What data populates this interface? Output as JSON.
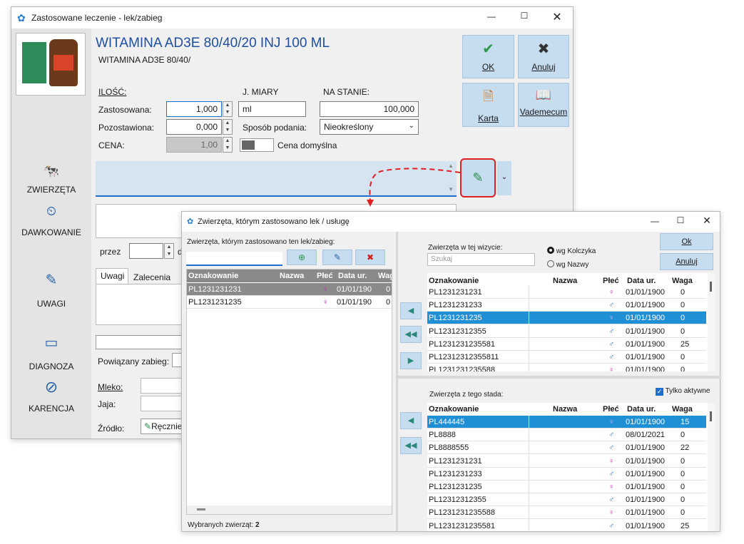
{
  "main": {
    "title": "Zastosowane leczenie - lek/zabieg",
    "drug_title": "WITAMINA AD3E 80/40/20 INJ 100 ML",
    "drug_subtitle": "WITAMINA AD3E 80/40/",
    "ilosc_label": "ILOŚĆ:",
    "jm_label": "J. MIARY",
    "na_stanie_label": "NA STANIE:",
    "zastosowana_label": "Zastosowana:",
    "zastosowana_value": "1,000",
    "jm_value": "ml",
    "na_stanie_value": "100,000",
    "pozostawiona_label": "Pozostawiona:",
    "pozostawiona_value": "0,000",
    "sposob_label": "Sposób podania:",
    "sposob_value": "Nieokreślony",
    "cena_label": "CENA:",
    "cena_value": "1,00",
    "cena_domyslna_label": "Cena domyślna",
    "ok_label": "OK",
    "anuluj_label": "Anuluj",
    "karta_label": "Karta",
    "vademecum_label": "Vademecum",
    "przez_label": "przez",
    "przez_suffix": "d",
    "tab_uwagi": "Uwagi",
    "tab_zalecenia": "Zalecenia",
    "powiazany_label": "Powiązany zabieg:",
    "mleko_label": "Mleko:",
    "jaja_label": "Jaja:",
    "zrodlo_label": "Źródło:",
    "zrodlo_value": "Ręcznie",
    "sidebar": [
      {
        "label": "ZWIERZĘTA",
        "icon": "cow-icon"
      },
      {
        "label": "DAWKOWANIE",
        "icon": "dosage-icon"
      },
      {
        "label": "UWAGI",
        "icon": "pencil-icon"
      },
      {
        "label": "DIAGNOZA",
        "icon": "diagnosis-icon"
      },
      {
        "label": "KARENCJA",
        "icon": "withdrawal-icon"
      }
    ]
  },
  "dialog": {
    "title": "Zwierzęta, którym zastosowano lek / usługę",
    "left_caption": "Zwierzęta, którym zastosowano ten lek/zabieg:",
    "left_columns": [
      "Oznakowanie",
      "Nazwa",
      "Płeć",
      "Data ur.",
      "Wag"
    ],
    "left_rows": [
      {
        "id": "PL1231231231",
        "name": "",
        "sex": "♀",
        "date": "01/01/190",
        "weight": "0"
      },
      {
        "id": "PL1231231235",
        "name": "",
        "sex": "♀",
        "date": "01/01/190",
        "weight": "0"
      }
    ],
    "selected_count_label": "Wybranych zwierząt:",
    "selected_count": "2",
    "visit_caption": "Zwierzęta w tej wizycie:",
    "search_placeholder": "Szukaj",
    "radio_kolczyk": "wg Kolczyka",
    "radio_nazwy": "wg Nazwy",
    "ok_label": "Ok",
    "anuluj_label": "Anuluj",
    "columns": [
      "Oznakowanie",
      "Nazwa",
      "Płeć",
      "Data ur.",
      "Waga"
    ],
    "visit_rows": [
      {
        "id": "PL1231231231",
        "name": "",
        "sex": "♀",
        "date": "01/01/1900",
        "weight": "0"
      },
      {
        "id": "PL1231231233",
        "name": "",
        "sex": "♂",
        "date": "01/01/1900",
        "weight": "0"
      },
      {
        "id": "PL1231231235",
        "name": "",
        "sex": "♀",
        "date": "01/01/1900",
        "weight": "0"
      },
      {
        "id": "PL1231231235​5",
        "name": "",
        "sex": "♂",
        "date": "01/01/1900",
        "weight": "0"
      },
      {
        "id": "PL12312312355​81",
        "name": "",
        "sex": "♂",
        "date": "01/01/1900",
        "weight": "25"
      },
      {
        "id": "PL123123123558​11",
        "name": "",
        "sex": "♂",
        "date": "01/01/1900",
        "weight": "0"
      },
      {
        "id": "PL12312312355​88",
        "name": "",
        "sex": "♀",
        "date": "01/01/1900",
        "weight": "0"
      }
    ],
    "herd_caption": "Zwierzęta z tego stada:",
    "only_active_label": "Tylko aktywne",
    "herd_rows": [
      {
        "id": "PL444445",
        "name": "",
        "sex": "♀",
        "date": "01/01/1900",
        "weight": "15"
      },
      {
        "id": "PL8888",
        "name": "",
        "sex": "♂",
        "date": "08/01/2021",
        "weight": "0"
      },
      {
        "id": "PL8888555",
        "name": "",
        "sex": "♂",
        "date": "01/01/1900",
        "weight": "22"
      },
      {
        "id": "PL1231231231",
        "name": "",
        "sex": "♀",
        "date": "01/01/1900",
        "weight": "0"
      },
      {
        "id": "PL1231231233",
        "name": "",
        "sex": "♂",
        "date": "01/01/1900",
        "weight": "0"
      },
      {
        "id": "PL1231231235",
        "name": "",
        "sex": "♀",
        "date": "01/01/1900",
        "weight": "0"
      },
      {
        "id": "PL12312312355",
        "name": "",
        "sex": "♂",
        "date": "01/01/1900",
        "weight": "0"
      },
      {
        "id": "PL12312312355​88",
        "name": "",
        "sex": "♀",
        "date": "01/01/1900",
        "weight": "0"
      },
      {
        "id": "PL12312312355​81",
        "name": "",
        "sex": "♂",
        "date": "01/01/1900",
        "weight": "25"
      }
    ]
  },
  "colors": {
    "accent": "#1f8fd6",
    "button_bg": "#c6dcef",
    "red_highlight": "#e02020"
  }
}
